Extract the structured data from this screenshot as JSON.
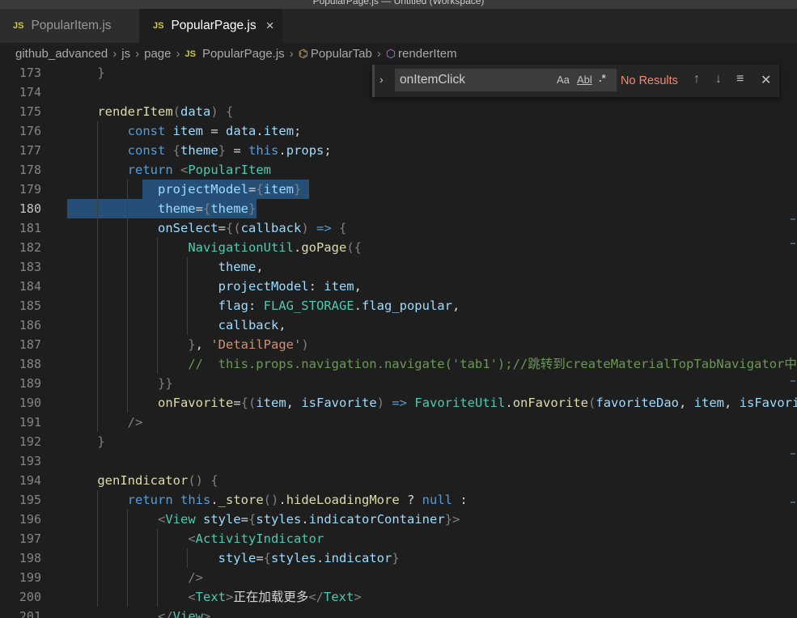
{
  "window": {
    "title": "PopularPage.js — Untitled (Workspace)"
  },
  "tabs": [
    {
      "icon": "JS",
      "label": "PopularItem.js"
    },
    {
      "icon": "JS",
      "label": "PopularPage.js",
      "close": "×"
    }
  ],
  "breadcrumb": {
    "items": [
      "github_advanced",
      "js",
      "page",
      "PopularPage.js",
      "PopularTab",
      "renderItem"
    ],
    "file_icon": "JS"
  },
  "find": {
    "value": "onItemClick",
    "match_case": "Aa",
    "whole_word": "Abl",
    "regex": ".*",
    "result": "No Results"
  },
  "editor": {
    "line_numbers": [
      "173",
      "174",
      "175",
      "176",
      "177",
      "178",
      "179",
      "180",
      "181",
      "182",
      "183",
      "184",
      "185",
      "186",
      "187",
      "188",
      "189",
      "190",
      "191",
      "192",
      "193",
      "194",
      "195",
      "196",
      "197",
      "198",
      "199",
      "200",
      "201"
    ],
    "current_line": "180",
    "lines": [
      "    }",
      "",
      "    renderItem(data) {",
      "        const item = data.item;",
      "        const {theme} = this.props;",
      "        return <PopularItem",
      "            projectModel={item}",
      "            theme={theme}",
      "            onSelect={(callback) => {",
      "                NavigationUtil.goPage({",
      "                    theme,",
      "                    projectModel: item,",
      "                    flag: FLAG_STORAGE.flag_popular,",
      "                    callback,",
      "                }, 'DetailPage')",
      "                //  this.props.navigation.navigate('tab1');//跳转到createMaterialTopTabNavigator中",
      "            }}",
      "            onFavorite={(item, isFavorite) => FavoriteUtil.onFavorite(favoriteDao, item, isFavorite, FLAG_STORAGE.flag_popular)}",
      "        />",
      "    }",
      "",
      "    genIndicator() {",
      "        return this._store().hideLoadingMore ? null :",
      "            <View style={styles.indicatorContainer}>",
      "                <ActivityIndicator",
      "                    style={styles.indicator}",
      "                />",
      "                <Text>正在加载更多</Text>",
      "            </View>"
    ]
  }
}
